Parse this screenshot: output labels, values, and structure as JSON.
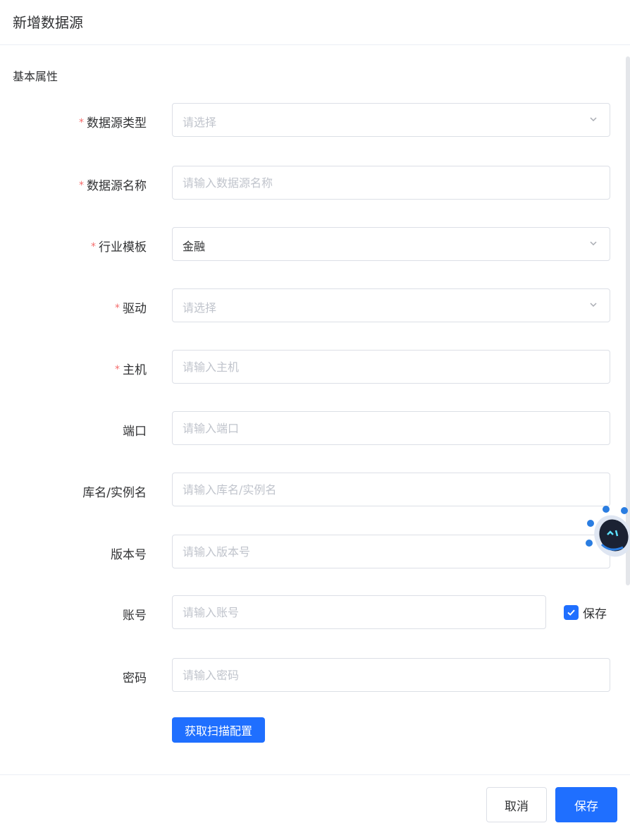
{
  "dialog": {
    "title": "新增数据源"
  },
  "section": {
    "title": "基本属性"
  },
  "fields": {
    "type": {
      "label": "数据源类型",
      "required": true,
      "placeholder": "请选择",
      "value": ""
    },
    "name": {
      "label": "数据源名称",
      "required": true,
      "placeholder": "请输入数据源名称",
      "value": ""
    },
    "industry": {
      "label": "行业模板",
      "required": true,
      "placeholder": "",
      "value": "金融"
    },
    "driver": {
      "label": "驱动",
      "required": true,
      "placeholder": "请选择",
      "value": ""
    },
    "host": {
      "label": "主机",
      "required": true,
      "placeholder": "请输入主机",
      "value": ""
    },
    "port": {
      "label": "端口",
      "required": false,
      "placeholder": "请输入端口",
      "value": ""
    },
    "db": {
      "label": "库名/实例名",
      "required": false,
      "placeholder": "请输入库名/实例名",
      "value": ""
    },
    "version": {
      "label": "版本号",
      "required": false,
      "placeholder": "请输入版本号",
      "value": ""
    },
    "account": {
      "label": "账号",
      "required": false,
      "placeholder": "请输入账号",
      "value": ""
    },
    "password": {
      "label": "密码",
      "required": false,
      "placeholder": "请输入密码",
      "value": ""
    }
  },
  "required_mark": "*",
  "save_account": {
    "label": "保存",
    "checked": true
  },
  "scan_button": {
    "label": "获取扫描配置"
  },
  "footer": {
    "cancel_label": "取消",
    "save_label": "保存"
  },
  "icons": {
    "select_arrow": "chevron-down-icon",
    "check": "check-icon",
    "assistant": "ai-robot-icon"
  },
  "colors": {
    "primary": "#1f6fff",
    "required": "#f56c6c",
    "placeholder": "#c0c4cc",
    "border": "#dcdfe6"
  }
}
